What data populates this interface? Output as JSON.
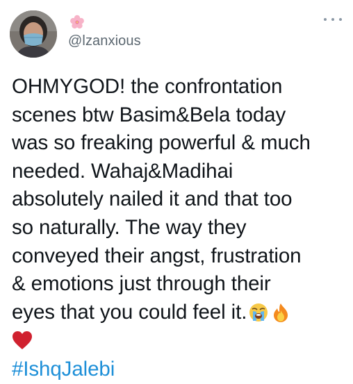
{
  "tweet": {
    "display_name_icon": "cherry-blossom-icon",
    "handle": "@lzanxious",
    "more_icon": "more-dots-icon",
    "lines": [
      "OHMYGOD! the confrontation",
      "scenes btw Basim&Bela today",
      "was so freaking powerful & much",
      "needed. Wahaj&Madihai",
      "absolutely nailed it and that too",
      "so naturally. The way they",
      "conveyed their angst, frustration",
      "& emotions just through their",
      "eyes that you could feel it."
    ],
    "emojis": [
      "loudly-crying-face-icon",
      "fire-icon",
      "red-heart-icon"
    ],
    "hashtag": "#IshqJalebi"
  },
  "colors": {
    "text": "#0f1419",
    "handle": "#5b6770",
    "link": "#1d8fd8",
    "heart": "#d0212f"
  }
}
